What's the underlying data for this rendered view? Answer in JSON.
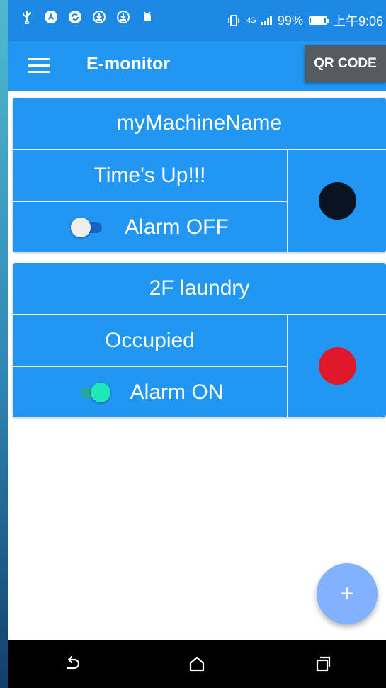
{
  "statusbar": {
    "icons": [
      "usb-icon",
      "navigation-icon",
      "sync-icon",
      "download-icon",
      "download-icon",
      "android-icon"
    ],
    "network": "4G",
    "battery": "99%",
    "battery_level": 0.99,
    "time": "上午9:06"
  },
  "appbar": {
    "title": "E-monitor",
    "qr_button": "QR CODE"
  },
  "machines": [
    {
      "name": "myMachineName",
      "status": "Time's Up!!!",
      "alarm_label": "Alarm OFF",
      "alarm_on": false,
      "indicator_color": "#061521"
    },
    {
      "name": "2F laundry",
      "status": "Occupied",
      "alarm_label": "Alarm ON",
      "alarm_on": true,
      "indicator_color": "#e0182c"
    }
  ],
  "fab": {
    "label": "+"
  },
  "colors": {
    "primary": "#2196f3",
    "statusbar": "#1e88e5",
    "fab": "#82b1ff",
    "toggle_on": "#1de9b6"
  }
}
